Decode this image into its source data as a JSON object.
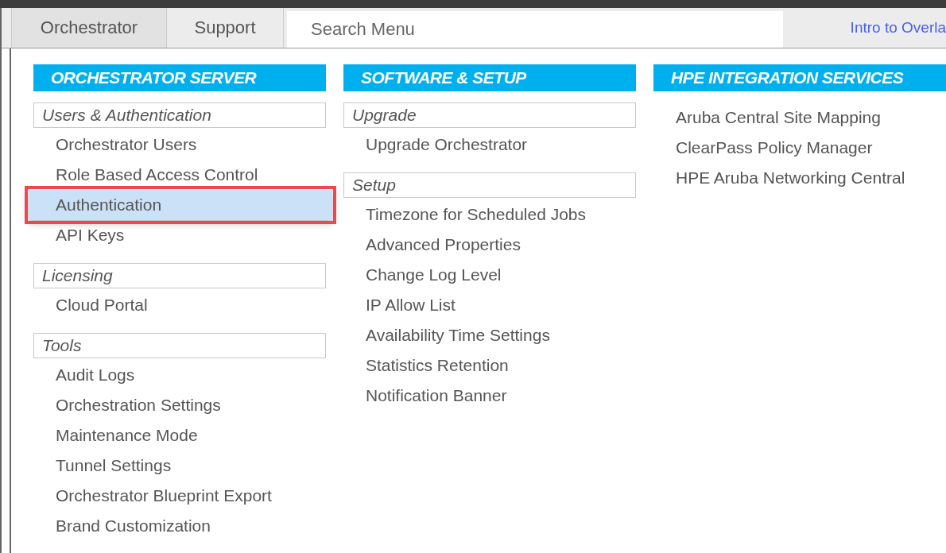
{
  "nav": {
    "tabs": [
      {
        "label": "Orchestrator",
        "selected": true
      },
      {
        "label": "Support",
        "selected": false
      }
    ],
    "search": {
      "placeholder": "Search Menu"
    },
    "link": "Intro to Overla"
  },
  "menu": {
    "columns": [
      {
        "title": "ORCHESTRATOR SERVER",
        "groups": [
          {
            "title": "Users & Authentication",
            "items": [
              {
                "label": "Orchestrator Users",
                "selected": false
              },
              {
                "label": "Role Based Access Control",
                "selected": false
              },
              {
                "label": "Authentication",
                "selected": true
              },
              {
                "label": "API Keys",
                "selected": false
              }
            ]
          },
          {
            "title": "Licensing",
            "items": [
              {
                "label": "Cloud Portal",
                "selected": false
              }
            ]
          },
          {
            "title": "Tools",
            "items": [
              {
                "label": "Audit Logs",
                "selected": false
              },
              {
                "label": "Orchestration Settings",
                "selected": false
              },
              {
                "label": "Maintenance Mode",
                "selected": false
              },
              {
                "label": "Tunnel Settings",
                "selected": false
              },
              {
                "label": "Orchestrator Blueprint Export",
                "selected": false
              },
              {
                "label": "Brand Customization",
                "selected": false
              }
            ]
          }
        ]
      },
      {
        "title": "SOFTWARE & SETUP",
        "groups": [
          {
            "title": "Upgrade",
            "items": [
              {
                "label": "Upgrade Orchestrator",
                "selected": false
              }
            ]
          },
          {
            "title": "Setup",
            "items": [
              {
                "label": "Timezone for Scheduled Jobs",
                "selected": false
              },
              {
                "label": "Advanced Properties",
                "selected": false
              },
              {
                "label": "Change Log Level",
                "selected": false
              },
              {
                "label": "IP Allow List",
                "selected": false
              },
              {
                "label": "Availability Time Settings",
                "selected": false
              },
              {
                "label": "Statistics Retention",
                "selected": false
              },
              {
                "label": "Notification Banner",
                "selected": false
              }
            ]
          }
        ]
      },
      {
        "title": "HPE INTEGRATION SERVICES",
        "groups": [
          {
            "items": [
              {
                "label": "Aruba Central Site Mapping",
                "selected": false
              },
              {
                "label": "ClearPass Policy Manager",
                "selected": false
              },
              {
                "label": "HPE Aruba Networking Central",
                "selected": false
              }
            ]
          }
        ]
      }
    ]
  }
}
